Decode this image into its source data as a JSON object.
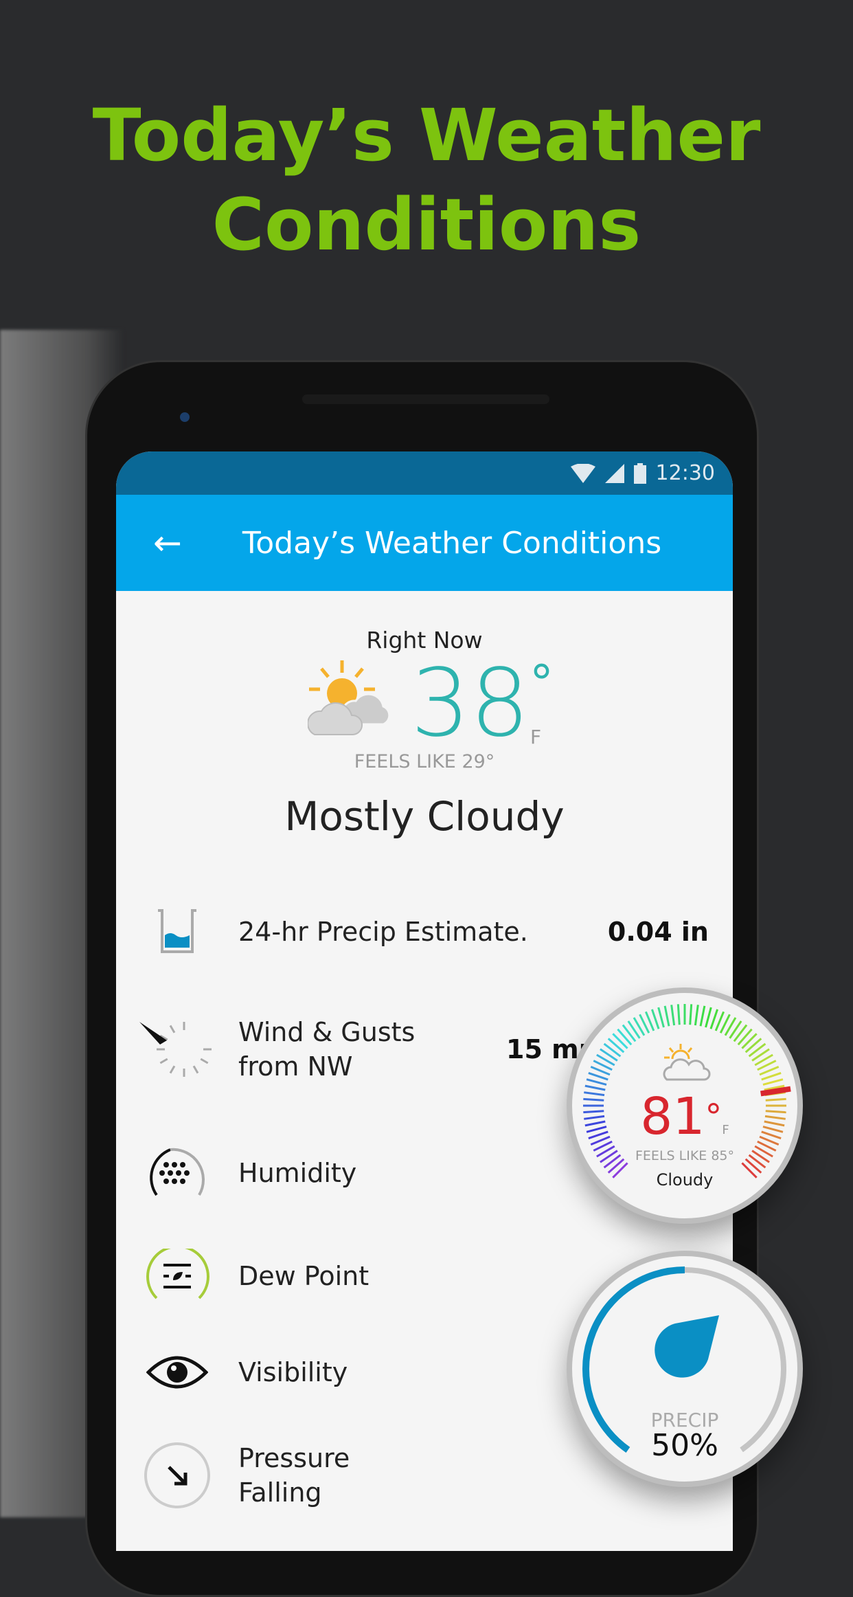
{
  "headline": [
    "Today’s Weather",
    "Conditions"
  ],
  "status_bar": {
    "time": "12:30",
    "icons": [
      "wifi-icon",
      "signal-icon",
      "battery-icon"
    ]
  },
  "app_bar": {
    "title": "Today’s Weather Conditions",
    "back_icon": "arrow-left-icon"
  },
  "current": {
    "label": "Right Now",
    "temp": "38",
    "degree": "°",
    "unit": "F",
    "feels_like": "FEELS LIKE 29°",
    "condition": "Mostly Cloudy",
    "icon": "partly-cloudy-icon"
  },
  "rows": [
    {
      "icon": "rain-gauge-icon",
      "label": "24-hr Precip Estimate.",
      "value": "0.04 in"
    },
    {
      "icon": "wind-compass-icon",
      "label": "Wind & Gusts",
      "label2": "from NW",
      "value": "15 mph"
    },
    {
      "icon": "humidity-icon",
      "label": "Humidity"
    },
    {
      "icon": "dew-point-icon",
      "label": "Dew Point"
    },
    {
      "icon": "eye-icon",
      "label": "Visibility"
    },
    {
      "icon": "pressure-arrow-icon",
      "label": "Pressure",
      "label2": "Falling"
    }
  ],
  "temp_gauge": {
    "temp": "81",
    "degree": "°",
    "unit": "F",
    "feels_like": "FEELS LIKE 85°",
    "condition": "Cloudy",
    "color": "#d8262e"
  },
  "precip_gauge": {
    "label": "PRECIP",
    "value": "50%",
    "percent": 50,
    "color": "#0a8fc4"
  },
  "colors": {
    "accent": "#7dc30f",
    "app_bar": "#04a6ea",
    "status_bar": "#0a6896",
    "temp": "#2eb3ae"
  }
}
